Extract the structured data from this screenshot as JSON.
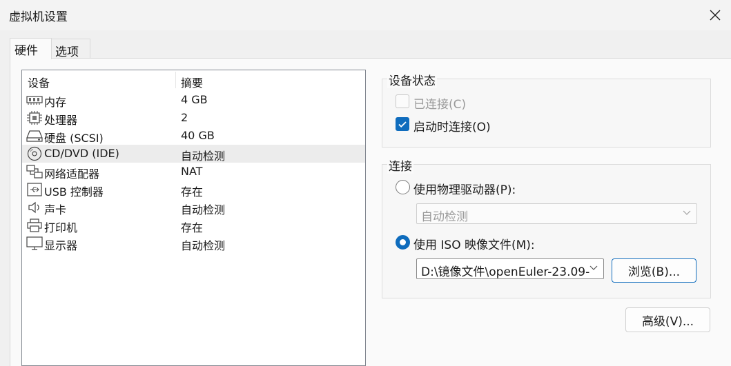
{
  "window": {
    "title": "虚拟机设置"
  },
  "tabs": [
    {
      "label": "硬件",
      "active": true
    },
    {
      "label": "选项",
      "active": false
    }
  ],
  "device_list": {
    "headers": {
      "device": "设备",
      "summary": "摘要"
    },
    "rows": [
      {
        "icon": "memory-icon",
        "name": "内存",
        "summary": "4 GB",
        "selected": false
      },
      {
        "icon": "cpu-icon",
        "name": "处理器",
        "summary": "2",
        "selected": false
      },
      {
        "icon": "harddisk-icon",
        "name": "硬盘 (SCSI)",
        "summary": "40 GB",
        "selected": false
      },
      {
        "icon": "cd-dvd-icon",
        "name": "CD/DVD (IDE)",
        "summary": "自动检测",
        "selected": true
      },
      {
        "icon": "network-icon",
        "name": "网络适配器",
        "summary": "NAT",
        "selected": false
      },
      {
        "icon": "usb-icon",
        "name": "USB 控制器",
        "summary": "存在",
        "selected": false
      },
      {
        "icon": "speaker-icon",
        "name": "声卡",
        "summary": "自动检测",
        "selected": false
      },
      {
        "icon": "printer-icon",
        "name": "打印机",
        "summary": "存在",
        "selected": false
      },
      {
        "icon": "monitor-icon",
        "name": "显示器",
        "summary": "自动检测",
        "selected": false
      }
    ]
  },
  "device_status": {
    "label": "设备状态",
    "connected": {
      "label": "已连接(C)",
      "checked": false,
      "enabled": false
    },
    "connect_at_power_on": {
      "label": "启动时连接(O)",
      "checked": true,
      "enabled": true
    }
  },
  "connection": {
    "label": "连接",
    "physical_drive": {
      "label": "使用物理驱动器(P):",
      "selected": false,
      "value": "自动检测"
    },
    "iso_image": {
      "label": "使用 ISO 映像文件(M):",
      "selected": true,
      "path": "D:\\镜像文件\\openEuler-23.09-"
    },
    "browse_label": "浏览(B)..."
  },
  "advanced_label": "高级(V)...",
  "colors": {
    "accent": "#0f6cbd",
    "selected_row": "#ececec",
    "disabled_text": "#9a9a9a"
  }
}
